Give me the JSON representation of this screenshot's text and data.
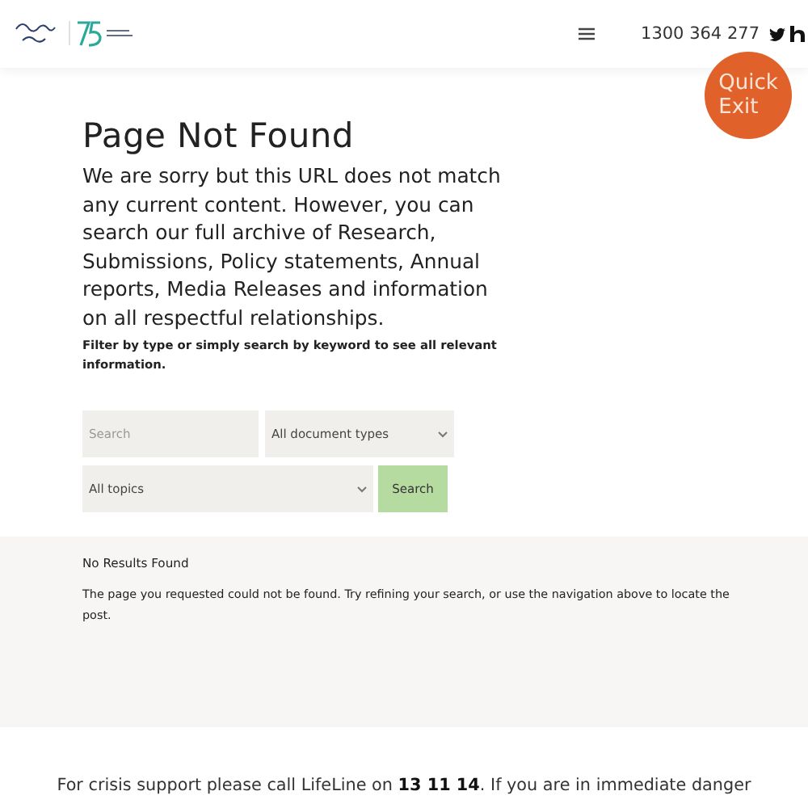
{
  "header": {
    "phone": "1300 364 277"
  },
  "quick_exit": {
    "lines": [
      "Quick",
      "Exit"
    ]
  },
  "page": {
    "title": "Page Not Found",
    "intro": "We are sorry but this URL does not match any current content. However, you can search our full archive of Research, Submissions, Policy statements, Annual reports, Media Releases and information on all respectful relationships.",
    "filter_note": "Filter by type or simply search by keyword to see all relevant information."
  },
  "search_form": {
    "search": {
      "placeholder": "Search"
    },
    "document_type": {
      "value": "All document types"
    },
    "topic": {
      "value": "All topics"
    },
    "button": "Search"
  },
  "results": {
    "heading": "No Results Found",
    "message": "The page you requested could not be found. Try refining your search, or use the navigation above to locate the post."
  },
  "footer": {
    "crisis": "For crisis support please call LifeLine on **13 11 14**. If you are in immediate danger"
  }
}
